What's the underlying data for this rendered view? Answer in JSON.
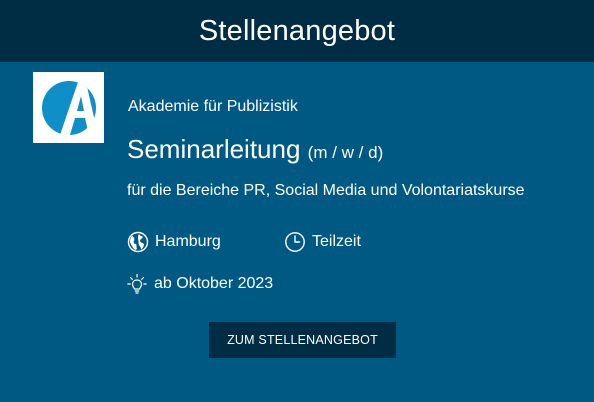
{
  "header": {
    "title": "Stellenangebot"
  },
  "company": {
    "name": "Akademie für Publizistik",
    "logo_icon": "akademie-logo-icon",
    "logo_colors": {
      "circle": "#0e8fc8",
      "letter": "#ffffff"
    }
  },
  "job": {
    "title": "Seminarleitung",
    "suffix": "(m / w / d)",
    "subtitle": "für die Bereiche PR, Social Media und Volontariatskurse"
  },
  "details": {
    "location": {
      "icon": "globe-icon",
      "label": "Hamburg"
    },
    "type": {
      "icon": "clock-icon",
      "label": "Teilzeit"
    },
    "start": {
      "icon": "lightbulb-icon",
      "label": "ab Oktober 2023"
    }
  },
  "cta": {
    "label": "ZUM STELLENANGEBOT"
  },
  "colors": {
    "background": "#005983",
    "header": "#002d44",
    "button": "#002d44",
    "text": "#ffffff"
  }
}
